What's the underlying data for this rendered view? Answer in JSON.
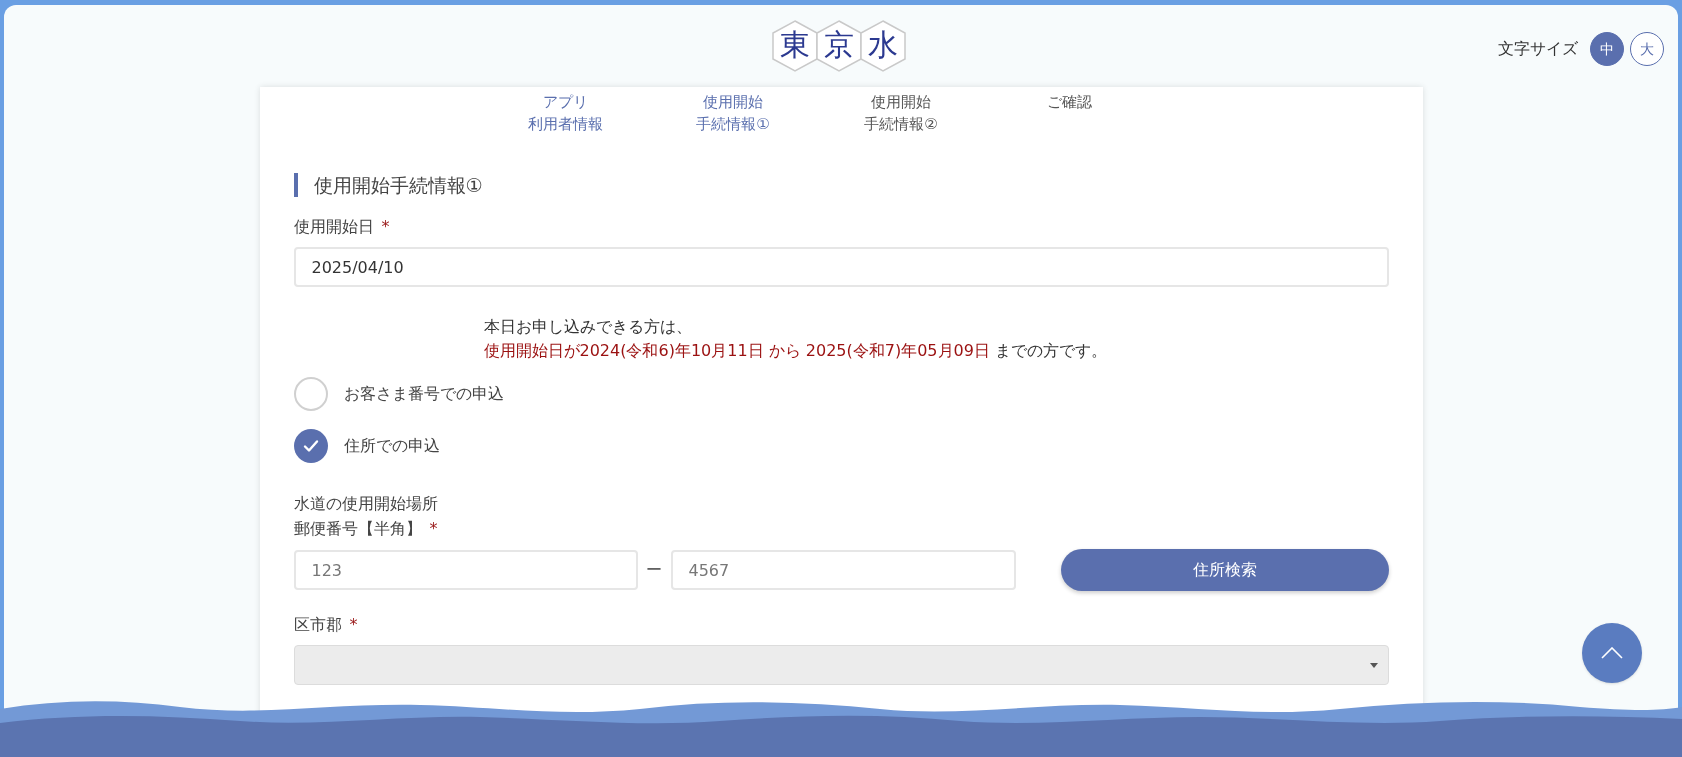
{
  "header": {
    "logo": [
      "東",
      "京",
      "水"
    ],
    "font_size": {
      "label": "文字サイズ",
      "options": [
        {
          "label": "中",
          "selected": true
        },
        {
          "label": "大",
          "selected": false
        }
      ]
    }
  },
  "steps": [
    {
      "lines": [
        "アプリ",
        "利用者情報"
      ],
      "reached": true
    },
    {
      "lines": [
        "使用開始",
        "手続情報①"
      ],
      "reached": true
    },
    {
      "lines": [
        "使用開始",
        "手続情報②"
      ],
      "reached": false
    },
    {
      "lines": [
        "ご確認"
      ],
      "reached": false
    }
  ],
  "section_title": "使用開始手続情報①",
  "start_date": {
    "label": "使用開始日",
    "required_mark": "*",
    "value": "2025/04/10"
  },
  "notice": {
    "line1": "本日お申し込みできる方は、",
    "line2": [
      {
        "text": "使用開始日が2024(令和6)年10月11日 から 2025(令和7)年05月09日",
        "highlight": true
      },
      {
        "text": " までの方です。",
        "highlight": false
      }
    ]
  },
  "apply_options": [
    {
      "label": "お客さま番号での申込",
      "selected": false
    },
    {
      "label": "住所での申込",
      "selected": true
    }
  ],
  "address": {
    "heading": "水道の使用開始場所",
    "postal_label": "郵便番号【半角】",
    "postal_required_mark": "*",
    "postal_first_placeholder": "123",
    "separator": "ー",
    "postal_second_placeholder": "4567",
    "search_button": "住所検索",
    "city_label": "区市郡",
    "city_required_mark": "*"
  }
}
